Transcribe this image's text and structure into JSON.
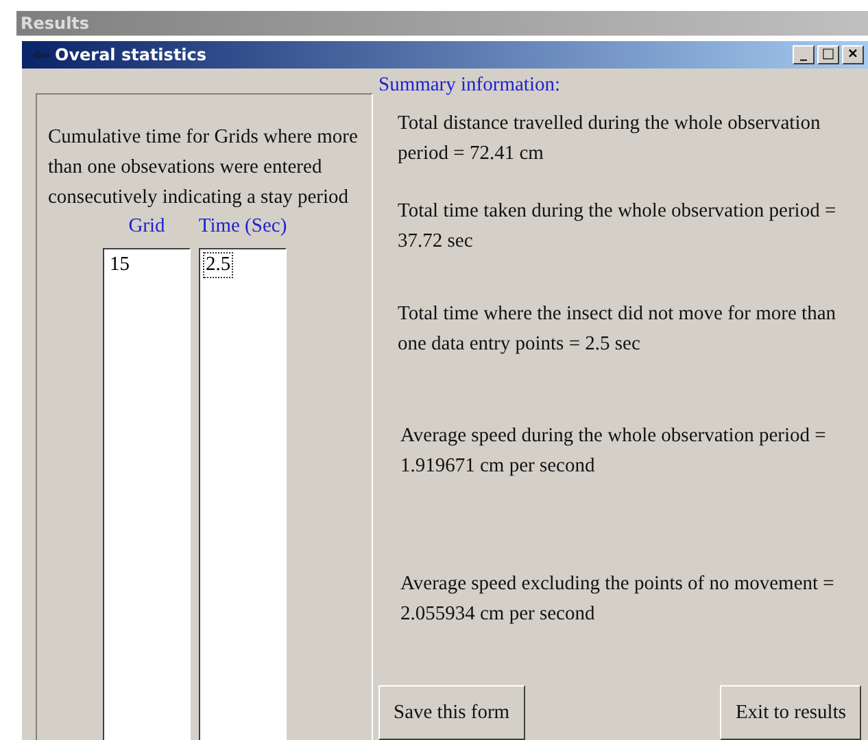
{
  "parent_window": {
    "title": "Results"
  },
  "window": {
    "title": "Overal statistics",
    "controls": [
      "_",
      "□",
      "×"
    ]
  },
  "stay_panel": {
    "description": "Cumulative time for Grids where more than one obsevations were entered consecutively indicating a stay period",
    "lists": [
      {
        "heading": "Grid",
        "items": [
          {
            "text": "15",
            "focused": false
          }
        ]
      },
      {
        "heading": "Time (Sec)",
        "items": [
          {
            "text": "2.5",
            "focused": true
          }
        ]
      }
    ]
  },
  "summary": {
    "heading": "Summary information:",
    "lines": [
      "Total distance travelled during the whole observation period = 72.41 cm",
      "Total time taken during the whole observation period = 37.72 sec",
      "Total time where the insect did not move for more than one data entry points = 2.5 sec",
      "Average speed during the whole observation period = 1.919671 cm per second",
      "Average speed excluding the points of no movement = 2.055934 cm per second"
    ]
  },
  "buttons": [
    "Save this form",
    "Exit to results"
  ]
}
